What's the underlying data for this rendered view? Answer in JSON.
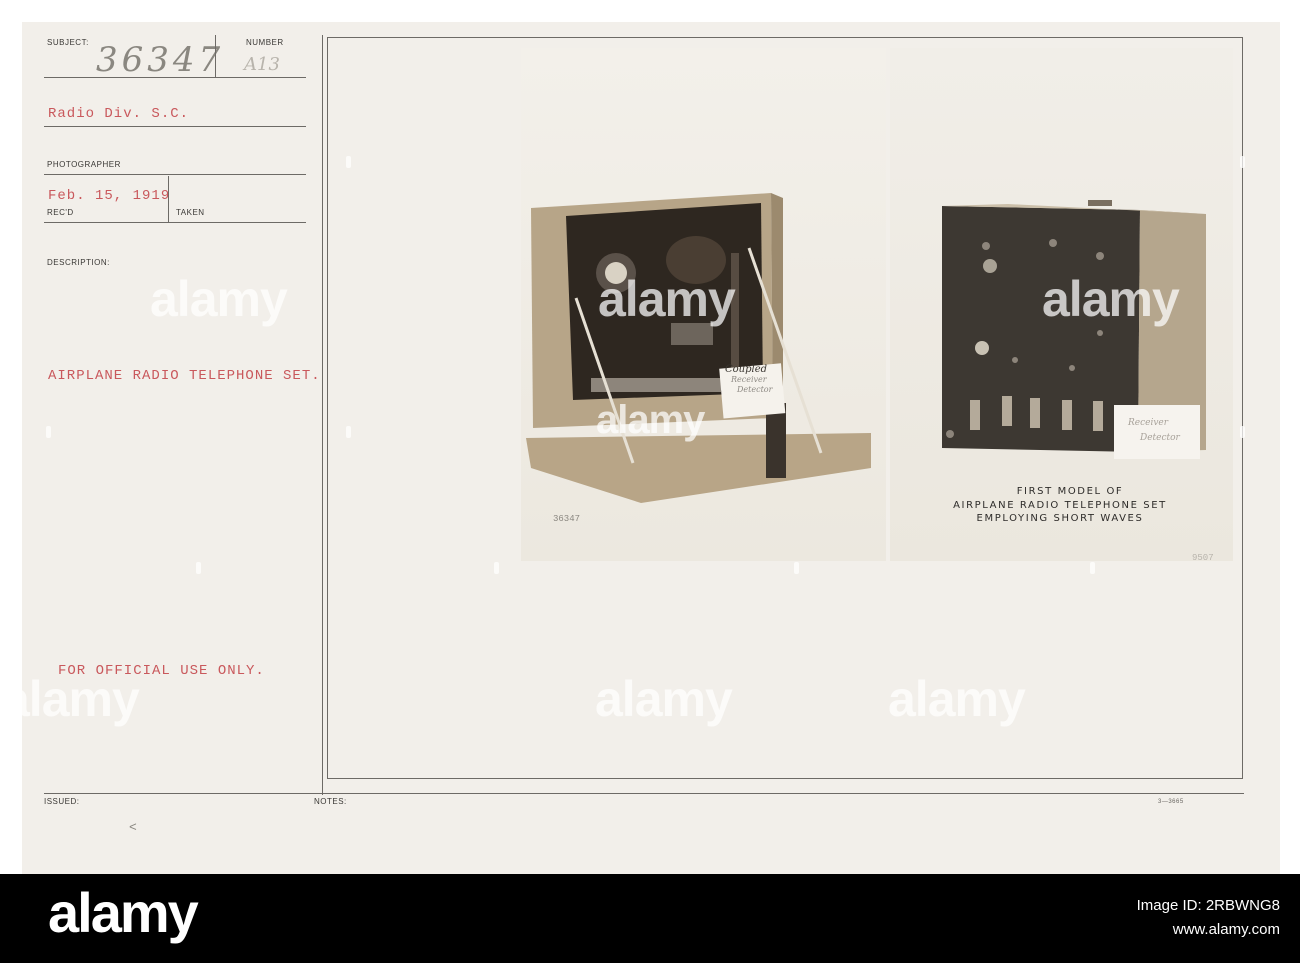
{
  "form": {
    "subject_label": "SUBJECT:",
    "subject_value": "36347",
    "number_label": "NUMBER",
    "number_value": "A13",
    "department": "Radio Div. S.C.",
    "photographer_label": "PHOTOGRAPHER",
    "date": "Feb. 15, 1919",
    "recd_label": "REC'D",
    "taken_label": "TAKEN",
    "description_label": "DESCRIPTION:",
    "description": "AIRPLANE RADIO TELEPHONE SET.",
    "restriction": "FOR OFFICIAL USE ONLY.",
    "issued_label": "ISSUED:",
    "issued_mark": "<",
    "notes_label": "NOTES:",
    "form_code": "3—3665"
  },
  "photos": {
    "left": {
      "card_line1": "Coupled",
      "card_line2": "Receiver",
      "card_line3": "Detector",
      "negative_number": "36347"
    },
    "right": {
      "card_line1": "Receiver",
      "card_line2": "Detector",
      "caption_line1": "FIRST MODEL OF",
      "caption_line2": "AIRPLANE RADIO TELEPHONE SET",
      "caption_line3": "EMPLOYING SHORT WAVES",
      "print_number": "9507"
    }
  },
  "watermark": {
    "text": "alamy"
  },
  "banner": {
    "logo": "alamy",
    "image_id_label": "Image ID: 2RBWNG8",
    "url": "www.alamy.com"
  }
}
